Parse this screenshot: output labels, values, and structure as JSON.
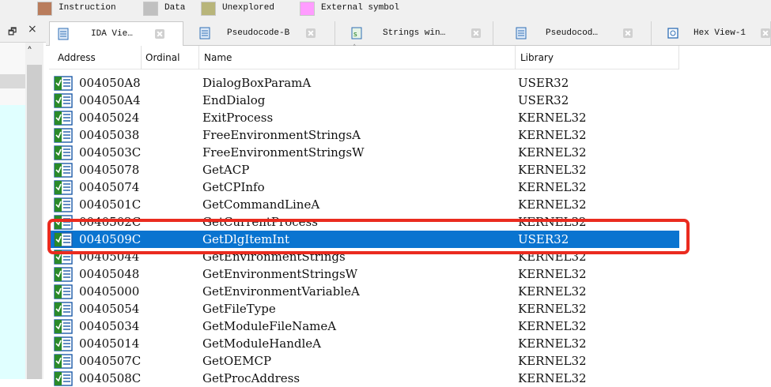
{
  "legend": [
    {
      "label": "Instruction",
      "color": "#b97c5c"
    },
    {
      "label": "Data",
      "color": "#c0c0c0"
    },
    {
      "label": "Unexplored",
      "color": "#b8b57a"
    },
    {
      "label": "External symbol",
      "color": "#ff9cff"
    }
  ],
  "left_pane": {
    "float_icon": "float-icon",
    "close_glyph": "×",
    "scroll_up_glyph": "˄"
  },
  "tabs": [
    {
      "label": "IDA Vie…",
      "icon": "ida-view-icon"
    },
    {
      "label": "Pseudocode-B",
      "icon": "pseudocode-icon"
    },
    {
      "label": "Strings win…",
      "icon": "strings-icon"
    },
    {
      "label": "Pseudocod…",
      "icon": "pseudocode-icon"
    },
    {
      "label": "Hex View-1",
      "icon": "hex-view-icon"
    }
  ],
  "table": {
    "headers": {
      "address": "Address",
      "ordinal": "Ordinal",
      "name": "Name",
      "library": "Library"
    },
    "rows": [
      {
        "address": "004050A8",
        "ordinal": "",
        "name": "DialogBoxParamA",
        "library": "USER32",
        "selected": false
      },
      {
        "address": "004050A4",
        "ordinal": "",
        "name": "EndDialog",
        "library": "USER32",
        "selected": false
      },
      {
        "address": "00405024",
        "ordinal": "",
        "name": "ExitProcess",
        "library": "KERNEL32",
        "selected": false
      },
      {
        "address": "00405038",
        "ordinal": "",
        "name": "FreeEnvironmentStringsA",
        "library": "KERNEL32",
        "selected": false
      },
      {
        "address": "0040503C",
        "ordinal": "",
        "name": "FreeEnvironmentStringsW",
        "library": "KERNEL32",
        "selected": false
      },
      {
        "address": "00405078",
        "ordinal": "",
        "name": "GetACP",
        "library": "KERNEL32",
        "selected": false
      },
      {
        "address": "00405074",
        "ordinal": "",
        "name": "GetCPInfo",
        "library": "KERNEL32",
        "selected": false
      },
      {
        "address": "0040501C",
        "ordinal": "",
        "name": "GetCommandLineA",
        "library": "KERNEL32",
        "selected": false
      },
      {
        "address": "0040502C",
        "ordinal": "",
        "name": "GetCurrentProcess",
        "library": "KERNEL32",
        "selected": false
      },
      {
        "address": "0040509C",
        "ordinal": "",
        "name": "GetDlgItemInt",
        "library": "USER32",
        "selected": true
      },
      {
        "address": "00405044",
        "ordinal": "",
        "name": "GetEnvironmentStrings",
        "library": "KERNEL32",
        "selected": false
      },
      {
        "address": "00405048",
        "ordinal": "",
        "name": "GetEnvironmentStringsW",
        "library": "KERNEL32",
        "selected": false
      },
      {
        "address": "00405000",
        "ordinal": "",
        "name": "GetEnvironmentVariableA",
        "library": "KERNEL32",
        "selected": false
      },
      {
        "address": "00405054",
        "ordinal": "",
        "name": "GetFileType",
        "library": "KERNEL32",
        "selected": false
      },
      {
        "address": "00405034",
        "ordinal": "",
        "name": "GetModuleFileNameA",
        "library": "KERNEL32",
        "selected": false
      },
      {
        "address": "00405014",
        "ordinal": "",
        "name": "GetModuleHandleA",
        "library": "KERNEL32",
        "selected": false
      },
      {
        "address": "0040507C",
        "ordinal": "",
        "name": "GetOEMCP",
        "library": "KERNEL32",
        "selected": false
      },
      {
        "address": "0040508C",
        "ordinal": "",
        "name": "GetProcAddress",
        "library": "KERNEL32",
        "selected": false
      }
    ]
  },
  "colors": {
    "selection": "#0a74d0",
    "highlight_box": "#ea2b1f",
    "legend_panel_cyan": "#e0ffff"
  }
}
